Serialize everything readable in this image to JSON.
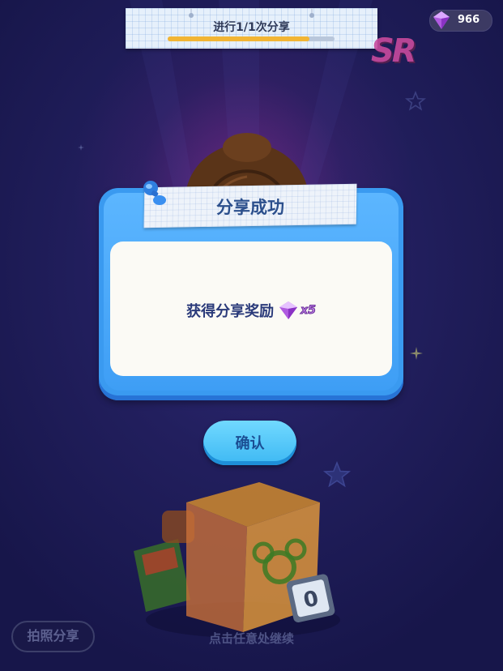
{
  "header": {
    "share_progress_text": "进行1/1次分享",
    "share_progress_fraction": 0.85
  },
  "currency": {
    "gem_count": "966",
    "icon": "purple-gem-icon"
  },
  "rarity_badge": "SR",
  "dialog": {
    "title": "分享成功",
    "reward_text": "获得分享奖励",
    "reward_icon": "purple-gem-icon",
    "reward_quantity": "x5"
  },
  "buttons": {
    "confirm_label": "确认",
    "photo_share_label": "拍照分享"
  },
  "footer": {
    "tap_to_continue": "点击任意处继续"
  },
  "colors": {
    "dialog_blue": "#3a9af0",
    "confirm_blue": "#3db8f3",
    "progress_fill": "#f2b534",
    "gem_purple": "#b05be0"
  }
}
